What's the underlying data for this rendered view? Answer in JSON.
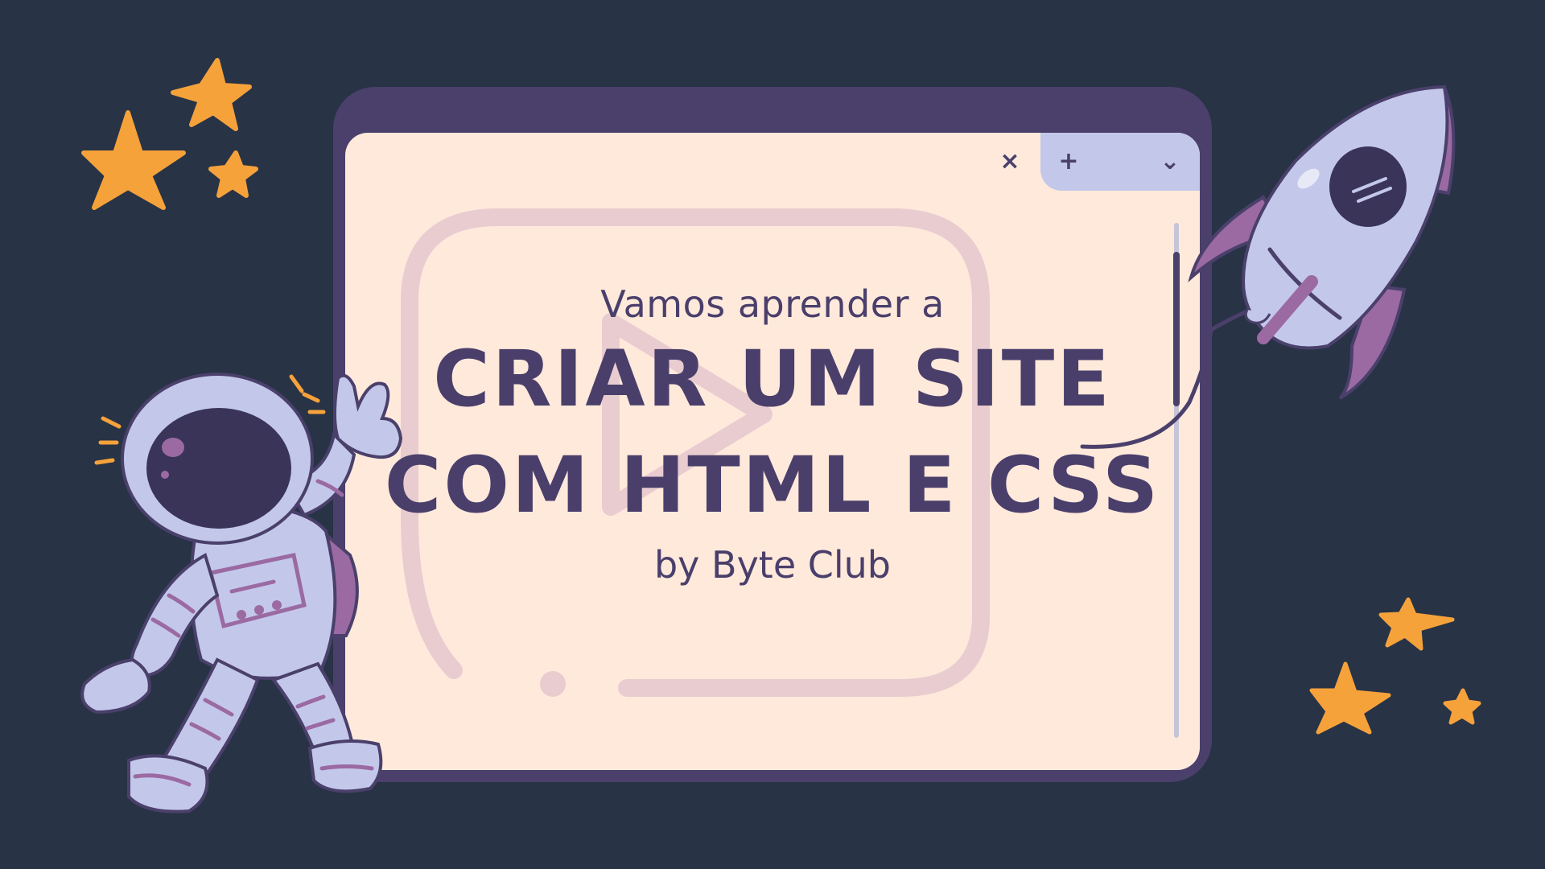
{
  "window": {
    "controls": {
      "close_label": "×",
      "new_tab_label": "+",
      "menu_label": "⌄"
    }
  },
  "hero": {
    "subtitle": "Vamos aprender a",
    "headline_line1": "CRIAR UM SITE",
    "headline_line2": "COM HTML E CSS",
    "byline": "by Byte Club"
  },
  "icons": {
    "background": "play-icon",
    "left_character": "astronaut-icon",
    "right_character": "rocket-icon",
    "decoration": "star-icon"
  },
  "colors": {
    "background": "#283346",
    "window_frame": "#4a406b",
    "window_body": "#ffe9db",
    "tab_strip": "#c3c8ea",
    "text": "#4a3f6b",
    "star": "#f6a23b",
    "suit": "#c3c8ea",
    "accent_purple": "#9b6aa3"
  }
}
